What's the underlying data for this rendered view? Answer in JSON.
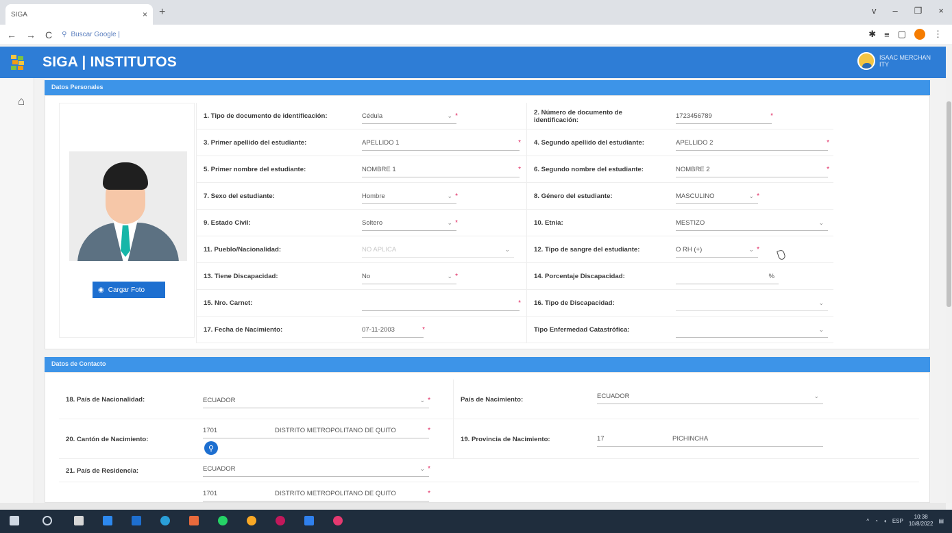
{
  "browser": {
    "tab_title": "SIGA",
    "tab_close": "×",
    "new_tab": "+",
    "address": "Buscar Google |",
    "window_controls": [
      "v",
      "–",
      "❐",
      "×"
    ]
  },
  "app": {
    "title": "SIGA | INSTITUTOS",
    "user_line1": "ISAAC MERCHAN",
    "user_line2": "ITY"
  },
  "sections": {
    "personal": "Datos Personales",
    "contact": "Datos de Contacto"
  },
  "photo": {
    "upload_label": "Cargar Foto"
  },
  "personal": {
    "r1": {
      "l1": "1. Tipo de documento de identificación:",
      "v1": "Cédula",
      "l2": "2. Número de documento de identificación:",
      "v2": "1723456789"
    },
    "r2": {
      "l1": "3. Primer apellido del estudiante:",
      "v1": "APELLIDO 1",
      "l2": "4. Segundo apellido del estudiante:",
      "v2": "APELLIDO 2"
    },
    "r3": {
      "l1": "5. Primer nombre del estudiante:",
      "v1": "NOMBRE 1",
      "l2": "6. Segundo nombre del estudiante:",
      "v2": "NOMBRE 2"
    },
    "r4": {
      "l1": "7. Sexo del estudiante:",
      "v1": "Hombre",
      "l2": "8. Género del estudiante:",
      "v2": "MASCULINO"
    },
    "r5": {
      "l1": "9. Estado Civil:",
      "v1": "Soltero",
      "l2": "10. Etnia:",
      "v2": "MESTIZO"
    },
    "r6": {
      "l1": "11. Pueblo/Nacionalidad:",
      "v1": "NO APLICA",
      "l2": "12. Tipo de sangre del estudiante:",
      "v2": "O RH (+)"
    },
    "r7": {
      "l1": "13. Tiene Discapacidad:",
      "v1": "No",
      "l2": "14. Porcentaje Discapacidad:",
      "v2": "%"
    },
    "r8": {
      "l1": "15. Nro. Carnet:",
      "v1": "",
      "l2": "16. Tipo de Discapacidad:",
      "v2": ""
    },
    "r9": {
      "l1": "17. Fecha de Nacimiento:",
      "v1": "07-11-2003",
      "l2": "Tipo Enfermedad Catastrófica:",
      "v2": ""
    }
  },
  "contact": {
    "c1": {
      "l1": "18. País de Nacionalidad:",
      "v1": "ECUADOR",
      "l2": "País de Nacimiento:",
      "v2": "ECUADOR"
    },
    "c2": {
      "l1": "20. Cantón de Nacimiento:",
      "code": "1701",
      "v1": "DISTRITO METROPOLITANO DE QUITO",
      "l2": "19. Provincia de Nacimiento:",
      "code2": "17",
      "v2": "PICHINCHA"
    },
    "c3": {
      "l1": "21. País de Residencia:",
      "v1": "ECUADOR"
    },
    "c4": {
      "code": "1701",
      "v1": "DISTRITO METROPOLITANO DE QUITO"
    }
  },
  "taskbar": {
    "lang": "ESP",
    "time": "10:38",
    "date": "10/8/2022"
  },
  "colors": {
    "header": "#2e7dd6",
    "section": "#3d94e8",
    "required": "#e0245e"
  }
}
